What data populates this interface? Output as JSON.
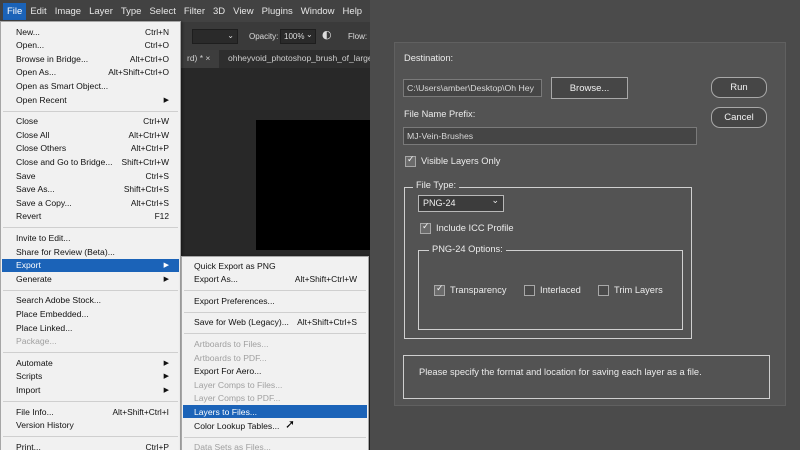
{
  "menubar": [
    "File",
    "Edit",
    "Image",
    "Layer",
    "Type",
    "Select",
    "Filter",
    "3D",
    "View",
    "Plugins",
    "Window",
    "Help"
  ],
  "options_bar": {
    "opacity_label": "Opacity:",
    "opacity_value": "100%",
    "flow_label": "Flow:"
  },
  "doc_tabs": [
    "rd) * ×",
    "ohheyvoid_photoshop_brush_of_large_..."
  ],
  "file_menu": [
    {
      "label": "New...",
      "shortcut": "Ctrl+N"
    },
    {
      "label": "Open...",
      "shortcut": "Ctrl+O"
    },
    {
      "label": "Browse in Bridge...",
      "shortcut": "Alt+Ctrl+O"
    },
    {
      "label": "Open As...",
      "shortcut": "Alt+Shift+Ctrl+O"
    },
    {
      "label": "Open as Smart Object...",
      "shortcut": ""
    },
    {
      "label": "Open Recent",
      "shortcut": "",
      "submenu": true
    },
    {
      "sep": true
    },
    {
      "label": "Close",
      "shortcut": "Ctrl+W"
    },
    {
      "label": "Close All",
      "shortcut": "Alt+Ctrl+W"
    },
    {
      "label": "Close Others",
      "shortcut": "Alt+Ctrl+P"
    },
    {
      "label": "Close and Go to Bridge...",
      "shortcut": "Shift+Ctrl+W"
    },
    {
      "label": "Save",
      "shortcut": "Ctrl+S"
    },
    {
      "label": "Save As...",
      "shortcut": "Shift+Ctrl+S"
    },
    {
      "label": "Save a Copy...",
      "shortcut": "Alt+Ctrl+S"
    },
    {
      "label": "Revert",
      "shortcut": "F12"
    },
    {
      "sep": true
    },
    {
      "label": "Invite to Edit...",
      "shortcut": ""
    },
    {
      "label": "Share for Review (Beta)...",
      "shortcut": ""
    },
    {
      "label": "Export",
      "shortcut": "",
      "submenu": true,
      "highlighted": true
    },
    {
      "label": "Generate",
      "shortcut": "",
      "submenu": true
    },
    {
      "sep": true
    },
    {
      "label": "Search Adobe Stock...",
      "shortcut": ""
    },
    {
      "label": "Place Embedded...",
      "shortcut": ""
    },
    {
      "label": "Place Linked...",
      "shortcut": ""
    },
    {
      "label": "Package...",
      "shortcut": "",
      "disabled": true
    },
    {
      "sep": true
    },
    {
      "label": "Automate",
      "shortcut": "",
      "submenu": true
    },
    {
      "label": "Scripts",
      "shortcut": "",
      "submenu": true
    },
    {
      "label": "Import",
      "shortcut": "",
      "submenu": true
    },
    {
      "sep": true
    },
    {
      "label": "File Info...",
      "shortcut": "Alt+Shift+Ctrl+I"
    },
    {
      "label": "Version History",
      "shortcut": ""
    },
    {
      "sep": true
    },
    {
      "label": "Print...",
      "shortcut": "Ctrl+P"
    }
  ],
  "export_menu": [
    {
      "label": "Quick Export as PNG",
      "shortcut": ""
    },
    {
      "label": "Export As...",
      "shortcut": "Alt+Shift+Ctrl+W"
    },
    {
      "sep": true
    },
    {
      "label": "Export Preferences...",
      "shortcut": ""
    },
    {
      "sep": true
    },
    {
      "label": "Save for Web (Legacy)...",
      "shortcut": "Alt+Shift+Ctrl+S"
    },
    {
      "sep": true
    },
    {
      "label": "Artboards to Files...",
      "shortcut": "",
      "disabled": true
    },
    {
      "label": "Artboards to PDF...",
      "shortcut": "",
      "disabled": true
    },
    {
      "label": "Export For Aero...",
      "shortcut": ""
    },
    {
      "label": "Layer Comps to Files...",
      "shortcut": "",
      "disabled": true
    },
    {
      "label": "Layer Comps to PDF...",
      "shortcut": "",
      "disabled": true
    },
    {
      "label": "Layers to Files...",
      "shortcut": "",
      "highlighted": true
    },
    {
      "label": "Color Lookup Tables...",
      "shortcut": ""
    },
    {
      "sep": true
    },
    {
      "label": "Data Sets as Files...",
      "shortcut": "",
      "disabled": true
    }
  ],
  "dialog": {
    "destination_label": "Destination:",
    "destination_value": "C:\\Users\\amber\\Desktop\\Oh Hey",
    "browse_label": "Browse...",
    "run_label": "Run",
    "cancel_label": "Cancel",
    "prefix_label": "File Name Prefix:",
    "prefix_value": "MJ-Vein-Brushes",
    "visible_layers_label": "Visible Layers Only",
    "visible_layers_checked": true,
    "file_type_label": "File Type:",
    "file_type_value": "PNG-24",
    "icc_label": "Include ICC Profile",
    "icc_checked": true,
    "png_options_label": "PNG-24 Options:",
    "transparency_label": "Transparency",
    "transparency_checked": true,
    "interlaced_label": "Interlaced",
    "interlaced_checked": false,
    "trim_label": "Trim Layers",
    "trim_checked": false,
    "message": "Please specify the format and location for saving each layer as a file."
  }
}
